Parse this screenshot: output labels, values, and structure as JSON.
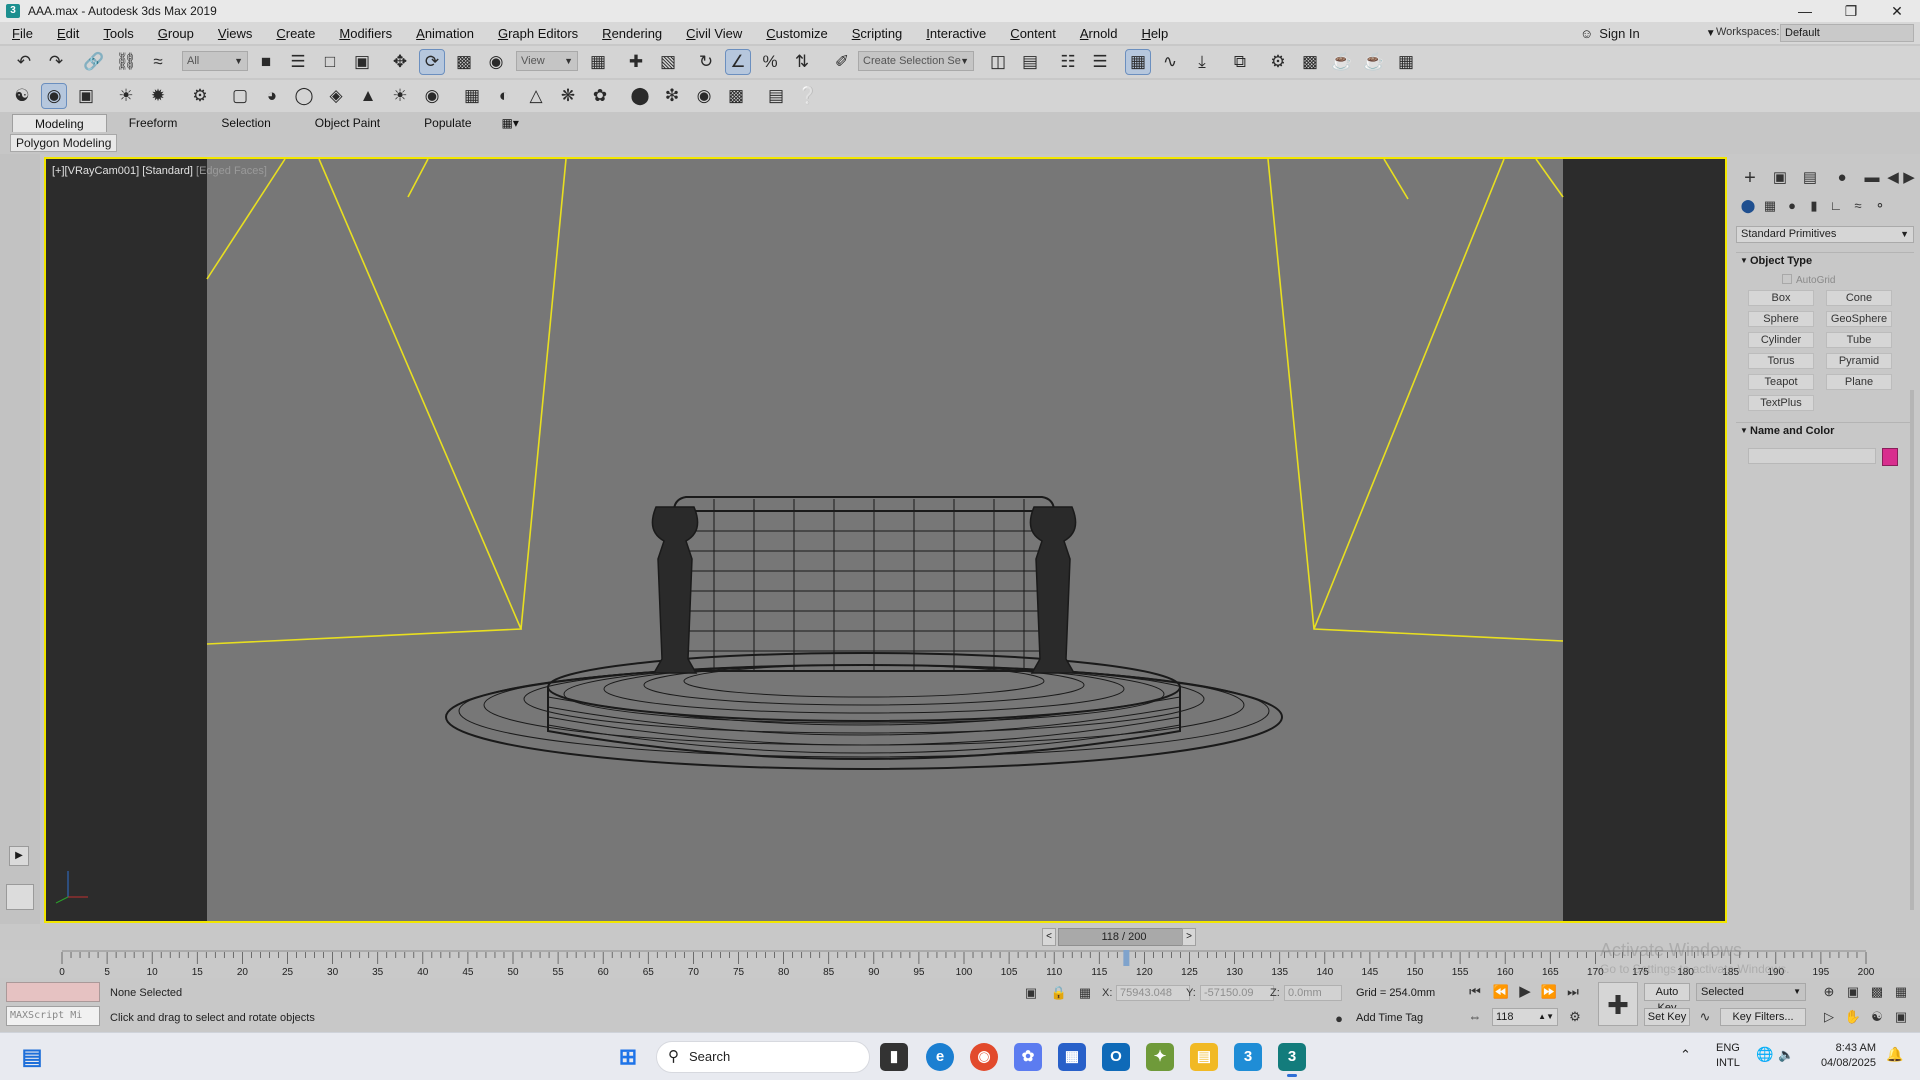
{
  "window": {
    "title": "AAA.max - Autodesk 3ds Max 2019",
    "minimize_glyph": "—",
    "restore_glyph": "❐",
    "close_glyph": "✕"
  },
  "menu": {
    "items": [
      "File",
      "Edit",
      "Tools",
      "Group",
      "Views",
      "Create",
      "Modifiers",
      "Animation",
      "Graph Editors",
      "Rendering",
      "Civil View",
      "Customize",
      "Scripting",
      "Interactive",
      "Content",
      "Arnold",
      "Help"
    ],
    "sign_in": "Sign In",
    "workspaces_label": "Workspaces:",
    "workspaces_value": "Default"
  },
  "toolbar": {
    "selection_filter": "All",
    "reference_coord": "View",
    "named_selection": "Create Selection Se"
  },
  "ribbon": {
    "tabs": [
      "Modeling",
      "Freeform",
      "Selection",
      "Object Paint",
      "Populate"
    ],
    "active_tab": "Modeling",
    "panel_label": "Polygon Modeling"
  },
  "viewport": {
    "label_plus": "[+]",
    "label_camera": "[VRayCam001]",
    "label_shading": "[Standard]",
    "label_faces": "[Edged Faces]",
    "border_color": "#f2e600",
    "background_color": "#777777"
  },
  "command_panel": {
    "category": "Standard Primitives",
    "object_type_title": "Object Type",
    "autogrid_label": "AutoGrid",
    "buttons": [
      "Box",
      "Cone",
      "Sphere",
      "GeoSphere",
      "Cylinder",
      "Tube",
      "Torus",
      "Pyramid",
      "Teapot",
      "Plane",
      "TextPlus"
    ],
    "name_color_title": "Name and Color",
    "object_color": "#d82e8e"
  },
  "timeline": {
    "current_frame": 118,
    "total_frames": 200,
    "frame_readout": "118 / 200",
    "ticks": [
      "0",
      "5",
      "10",
      "15",
      "20",
      "25",
      "30",
      "35",
      "40",
      "45",
      "50",
      "55",
      "60",
      "65",
      "70",
      "75",
      "80",
      "85",
      "90",
      "95",
      "100",
      "105",
      "110",
      "115",
      "120",
      "125",
      "130",
      "135",
      "140",
      "145",
      "150",
      "155",
      "160",
      "165",
      "170",
      "175",
      "180",
      "185",
      "190",
      "195",
      "200"
    ]
  },
  "status": {
    "script_placeholder": "MAXScript Mi",
    "selection": "None Selected",
    "prompt": "Click and drag to select and rotate objects",
    "x_label": "X:",
    "x_value": "75943.048",
    "y_label": "Y:",
    "y_value": "-57150.09",
    "z_label": "Z:",
    "z_value": "0.0mm",
    "grid": "Grid = 254.0mm",
    "add_time_tag": "Add Time Tag",
    "frame_field": "118",
    "auto_key": "Auto Key",
    "set_key": "Set Key",
    "selected_combo": "Selected",
    "key_filters": "Key Filters...",
    "watermark_title": "Activate Windows",
    "watermark_sub": "Go to Settings to activate Windows."
  },
  "taskbar": {
    "search_placeholder": "Search",
    "lang_line1": "ENG",
    "lang_line2": "INTL",
    "time": "8:43 AM",
    "date": "04/08/2025"
  }
}
